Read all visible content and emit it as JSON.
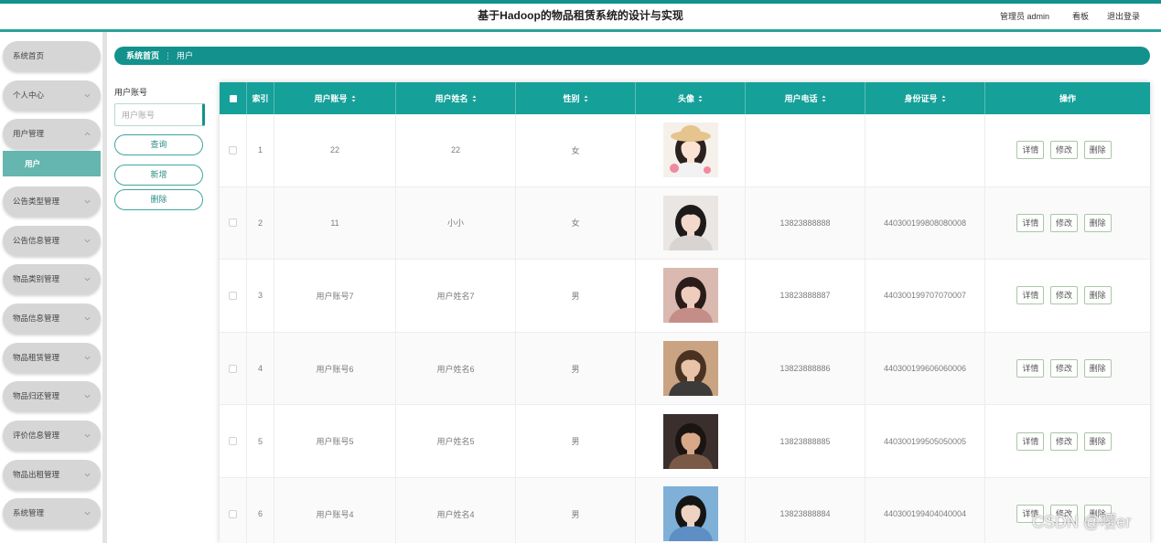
{
  "header": {
    "title": "基于Hadoop的物品租赁系统的设计与实现",
    "user_label": "管理员 admin",
    "dashboard_label": "看板",
    "logout_label": "退出登录"
  },
  "sidebar": {
    "items": [
      {
        "label": "系统首页"
      },
      {
        "label": "个人中心",
        "expanded": false
      },
      {
        "label": "用户管理",
        "expanded": true,
        "children": [
          {
            "label": "用户",
            "active": true
          }
        ]
      },
      {
        "label": "公告类型管理",
        "expanded": false
      },
      {
        "label": "公告信息管理",
        "expanded": false
      },
      {
        "label": "物品类别管理",
        "expanded": false
      },
      {
        "label": "物品信息管理",
        "expanded": false
      },
      {
        "label": "物品租赁管理",
        "expanded": false
      },
      {
        "label": "物品归还管理",
        "expanded": false
      },
      {
        "label": "评价信息管理",
        "expanded": false
      },
      {
        "label": "物品出租管理",
        "expanded": false
      },
      {
        "label": "系统管理",
        "expanded": false
      }
    ]
  },
  "breadcrumb": {
    "home": "系统首页",
    "separator": "⋮",
    "current": "用户"
  },
  "search": {
    "label": "用户账号",
    "placeholder": "用户账号",
    "value": ""
  },
  "side_buttons": {
    "query": "查询",
    "add": "新增",
    "delete": "删除"
  },
  "table": {
    "columns": [
      {
        "label": "索引",
        "sortable": false
      },
      {
        "label": "用户账号",
        "sortable": true
      },
      {
        "label": "用户姓名",
        "sortable": true
      },
      {
        "label": "性别",
        "sortable": true
      },
      {
        "label": "头像",
        "sortable": true
      },
      {
        "label": "用户电话",
        "sortable": true
      },
      {
        "label": "身份证号",
        "sortable": true
      },
      {
        "label": "操作",
        "sortable": false
      }
    ],
    "rows": [
      {
        "index": 1,
        "account": "22",
        "name": "22",
        "gender": "女",
        "phone": "",
        "id_number": "",
        "avatar": {
          "bg": "#f5f1ea",
          "hair": "#2b211f",
          "skin": "#fbe3d3",
          "cloth": "#f2f2f2",
          "hat": "#e6c48d",
          "accent": "#f08aa0"
        }
      },
      {
        "index": 2,
        "account": "11",
        "name": "小小",
        "gender": "女",
        "phone": "13823888888",
        "id_number": "440300199808080008",
        "avatar": {
          "bg": "#e9e6e4",
          "hair": "#1e1a1a",
          "skin": "#f3d9cc",
          "cloth": "#d8d4d2"
        }
      },
      {
        "index": 3,
        "account": "用户账号7",
        "name": "用户姓名7",
        "gender": "男",
        "phone": "13823888887",
        "id_number": "440300199707070007",
        "avatar": {
          "bg": "#d9b9b0",
          "hair": "#2a1c18",
          "skin": "#efcdbd",
          "cloth": "#c58d87"
        }
      },
      {
        "index": 4,
        "account": "用户账号6",
        "name": "用户姓名6",
        "gender": "男",
        "phone": "13823888886",
        "id_number": "440300199606060006",
        "avatar": {
          "bg": "#c9a382",
          "hair": "#4a3222",
          "skin": "#e8c3a8",
          "cloth": "#3d3a3a"
        }
      },
      {
        "index": 5,
        "account": "用户账号5",
        "name": "用户姓名5",
        "gender": "男",
        "phone": "13823888885",
        "id_number": "440300199505050005",
        "avatar": {
          "bg": "#3a2f2c",
          "hair": "#1a1412",
          "skin": "#d9a889",
          "cloth": "#7a5a46"
        }
      },
      {
        "index": 6,
        "account": "用户账号4",
        "name": "用户姓名4",
        "gender": "男",
        "phone": "13823888884",
        "id_number": "440300199404040004",
        "avatar": {
          "bg": "#7fb0d8",
          "hair": "#151515",
          "skin": "#efd3c2",
          "cloth": "#5d8fc4"
        }
      }
    ],
    "row_actions": {
      "detail": "详情",
      "edit": "修改",
      "delete": "删除"
    }
  },
  "watermark": "CSDN @嘤er",
  "colors": {
    "accent": "#13928d",
    "table_header": "#15a099",
    "sidebar_pill": "#d6d6d6",
    "sidebar_active": "#64b6ae",
    "action_button_border": "#a9c7a6"
  }
}
